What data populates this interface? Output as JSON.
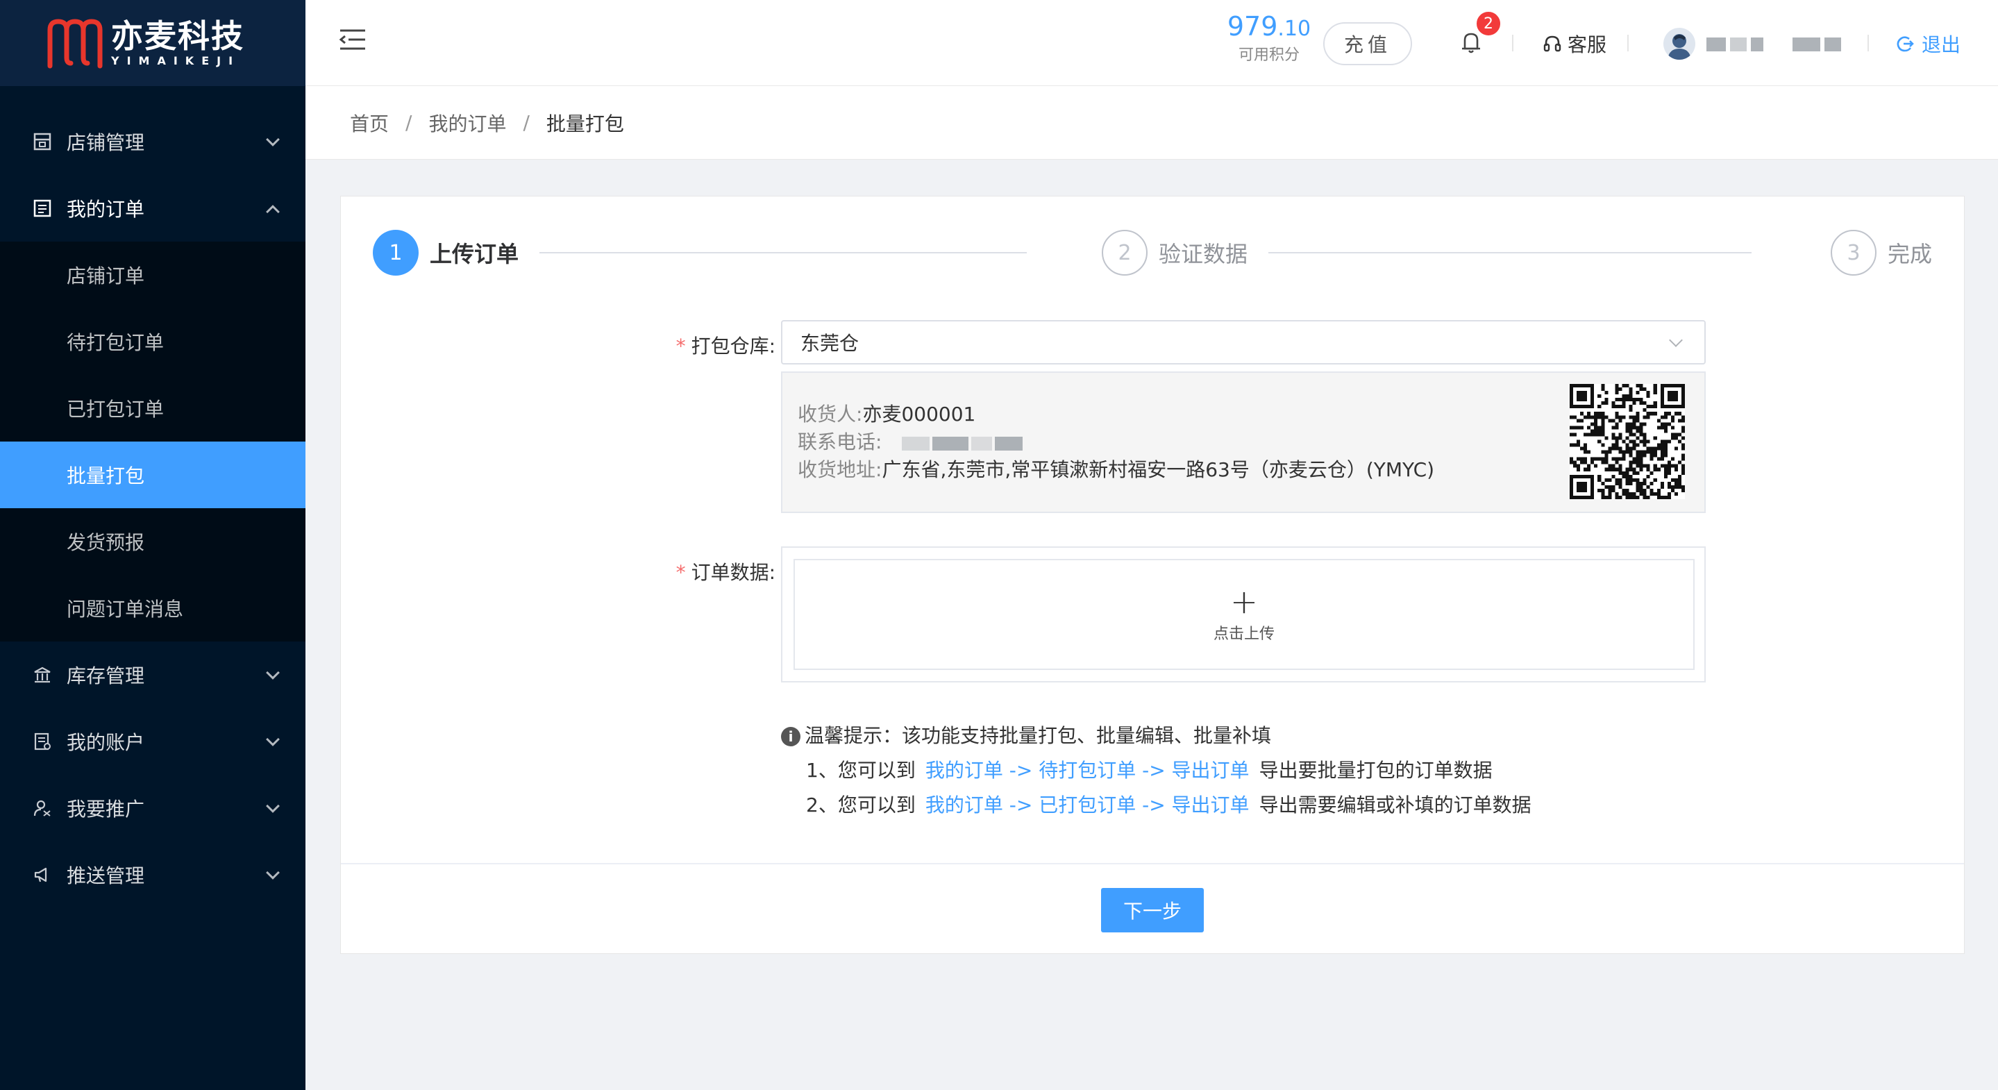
{
  "brand": {
    "name_cn": "亦麦科技",
    "name_en": "YIMAIKEJI",
    "colors": {
      "sidebar": "#001529",
      "accent": "#409eff",
      "badge": "#f23a3a"
    }
  },
  "sidebar": {
    "menus": [
      {
        "label": "店铺管理",
        "icon": "shop-icon",
        "expanded": false
      },
      {
        "label": "我的订单",
        "icon": "order-list-icon",
        "expanded": true,
        "children": [
          "店铺订单",
          "待打包订单",
          "已打包订单",
          "批量打包",
          "发货预报",
          "问题订单消息"
        ],
        "active_child": "批量打包"
      },
      {
        "label": "库存管理",
        "icon": "bank-icon",
        "expanded": false
      },
      {
        "label": "我的账户",
        "icon": "account-icon",
        "expanded": false
      },
      {
        "label": "我要推广",
        "icon": "promote-icon",
        "expanded": false
      },
      {
        "label": "推送管理",
        "icon": "megaphone-icon",
        "expanded": false
      }
    ]
  },
  "header": {
    "points_int": "979",
    "points_dec": ".10",
    "points_label": "可用积分",
    "recharge_label": "充值",
    "notifications": "2",
    "service_label": "客服",
    "logout_label": "退出"
  },
  "breadcrumb": [
    "首页",
    "我的订单",
    "批量打包"
  ],
  "steps": [
    {
      "num": "1",
      "title": "上传订单",
      "state": "active"
    },
    {
      "num": "2",
      "title": "验证数据",
      "state": "idle"
    },
    {
      "num": "3",
      "title": "完成",
      "state": "idle"
    }
  ],
  "form": {
    "warehouse_label": "打包仓库:",
    "warehouse_value": "东莞仓",
    "receiver_label": "收货人:",
    "receiver_value": "亦麦000001",
    "phone_label": "联系电话:",
    "address_label": "收货地址:",
    "address_value": "广东省,东莞市,常平镇漱新村福安一路63号（亦麦云仓）(YMYC)",
    "order_data_label": "订单数据:",
    "upload_text": "点击上传"
  },
  "tips": {
    "title": "温馨提示：该功能支持批量打包、批量编辑、批量补填",
    "line1_prefix": "1、您可以到",
    "line1_link": "我的订单 -> 待打包订单 -> 导出订单",
    "line1_suffix": "导出要批量打包的订单数据",
    "line2_prefix": "2、您可以到",
    "line2_link": "我的订单 -> 已打包订单 -> 导出订单",
    "line2_suffix": "导出需要编辑或补填的订单数据"
  },
  "next_button": "下一步"
}
